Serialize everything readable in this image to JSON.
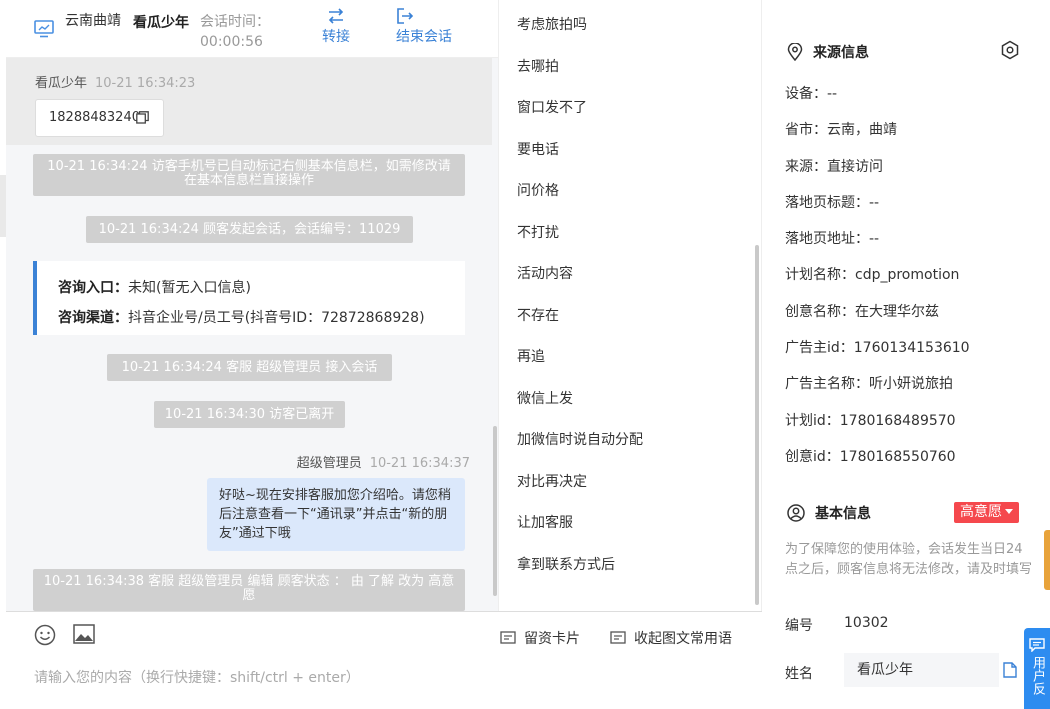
{
  "header": {
    "location": "云南曲靖",
    "visitor_name": "看瓜少年",
    "session_time_label": "会话时间：",
    "session_time": "00:00:56",
    "transfer_label": "转接",
    "end_label": "结束会话"
  },
  "chat": {
    "visitor_sender": "看瓜少年",
    "visitor_time": "10-21 16:34:23",
    "visitor_phone": "18288483240",
    "system_1": "10-21 16:34:24 访客手机号已自动标记右侧基本信息栏，如需修改请在基本信息栏直接操作",
    "system_2": "10-21 16:34:24 顾客发起会话，会话编号：11029",
    "entry_label": "咨询入口：",
    "entry_value": "未知(暂无入口信息)",
    "channel_label": "咨询渠道：",
    "channel_value": "抖音企业号/员工号(抖音号ID：72872868928)",
    "system_3": "10-21 16:34:24 客服 超级管理员 接入会话",
    "system_4": "10-21 16:34:30 访客已离开",
    "agent_sender": "超级管理员",
    "agent_time": "10-21 16:34:37",
    "agent_message": "好哒~现在安排客服加您介绍哈。请您稍后注意查看一下“通讯录”并点击“新的朋友”通过下哦",
    "system_5": "10-21 16:34:38 客服 超级管理员 编辑 顾客状态 ： 由 了解 改为 高意愿"
  },
  "input": {
    "card_label": "留资卡片",
    "phrases_label": "收起图文常用语",
    "placeholder": "请输入您的内容（换行快捷键：shift/ctrl + enter）"
  },
  "phrases": [
    "考虑旅拍吗",
    "去哪拍",
    "窗口发不了",
    "要电话",
    "问价格",
    "不打扰",
    "活动内容",
    "不存在",
    "再追",
    "微信上发",
    "加微信时说自动分配",
    "对比再决定",
    "让加客服",
    "拿到联系方式后"
  ],
  "info": {
    "source_title": "来源信息",
    "source_items": [
      "设备：--",
      "省市：云南，曲靖",
      "来源：直接访问",
      "落地页标题：--",
      "落地页地址：--",
      "计划名称：cdp_promotion",
      "创意名称：在大理华尔兹",
      "广告主id：1760134153610",
      "广告主名称：听小妍说旅拍",
      "计划id：1780168489570",
      "创意id：1780168550760"
    ],
    "basic_title": "基本信息",
    "intent_label": "高意愿",
    "notice": "为了保障您的使用体验，会话发生当日24点之后，顾客信息将无法修改，请及时填写",
    "no_label": "编号",
    "no_value": "10302",
    "name_label": "姓名",
    "name_value": "看瓜少年"
  },
  "feedback": {
    "label": "用户反"
  },
  "colors": {
    "accent": "#3b82d6",
    "intent": "#f5484d",
    "system_bg": "#d0d0d0",
    "agent_bubble": "#dbe8fb"
  }
}
